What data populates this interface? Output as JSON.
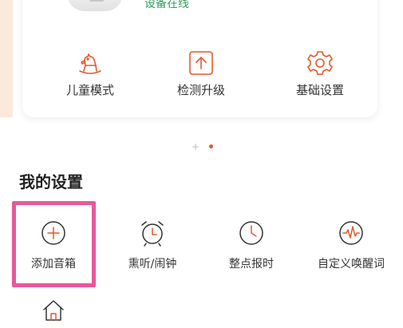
{
  "device": {
    "status": "设备在线"
  },
  "actions": [
    {
      "label": "儿童模式",
      "icon": "rocking-horse-icon"
    },
    {
      "label": "检测升级",
      "icon": "upgrade-icon"
    },
    {
      "label": "基础设置",
      "icon": "gear-icon"
    }
  ],
  "pager": {
    "inactive_glyph": "+"
  },
  "settings": {
    "title": "我的设置",
    "items": [
      {
        "label": "添加音箱",
        "icon": "add-circle-icon"
      },
      {
        "label": "熏听/闹钟",
        "icon": "alarm-clock-icon"
      },
      {
        "label": "整点报时",
        "icon": "clock-icon"
      },
      {
        "label": "自定义唤醒词",
        "icon": "waveform-icon"
      }
    ]
  },
  "colors": {
    "accent": "#e25a2c",
    "online": "#2ea05a",
    "highlight": "#e8579c"
  },
  "bottom_icon": "home-icon"
}
